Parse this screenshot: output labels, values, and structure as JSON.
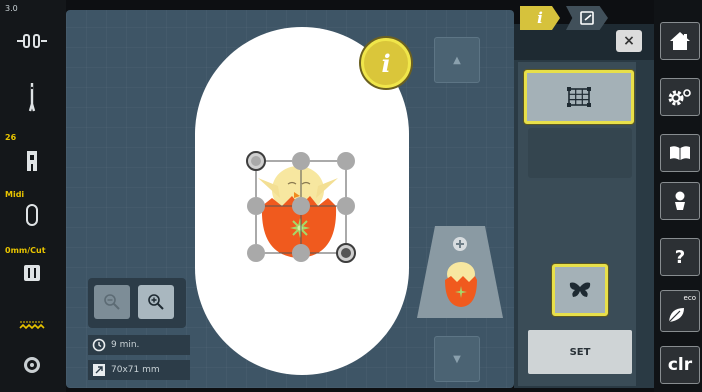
{
  "status_bar": {
    "thread_tension": "3.0",
    "needle_position": "26",
    "presser_foot": "Midi",
    "cut_setting": "0mm/Cut"
  },
  "canvas": {
    "info_label": "i",
    "hoop_color": "#ffffff",
    "background_color": "#3e5566"
  },
  "motif": {
    "name": "chick-in-egg",
    "shell_color": "#f05a1e",
    "chick_color": "#f7e7a0",
    "flower_color": "#a6d96a"
  },
  "zoom": {
    "zoom_out_icon": "zoom-out-icon",
    "zoom_in_icon": "zoom-in-icon"
  },
  "info": {
    "time": "9 min.",
    "size": "70x71 mm"
  },
  "panel": {
    "tab_info": "i",
    "close": "×",
    "set_label": "SET",
    "accent_color": "#e8e04a"
  },
  "nav": {
    "home_icon": "home-icon",
    "settings_icon": "settings-icon",
    "tutorial_icon": "book-icon",
    "embroidery_consultant_icon": "consultant-icon",
    "help_icon": "help-icon",
    "help_label": "?",
    "eco_label": "eco",
    "clr_label": "clr"
  }
}
